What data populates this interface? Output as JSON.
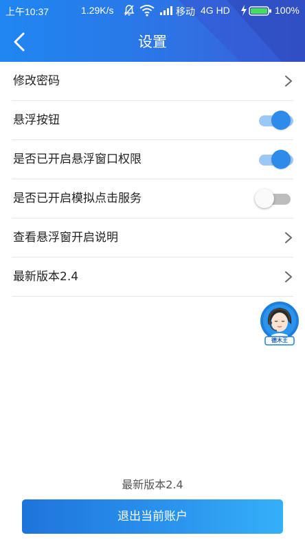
{
  "status_bar": {
    "time": "上午10:37",
    "network_speed": "1.29K/s",
    "carrier": "移动",
    "network_type": "4G HD",
    "battery_percent": "100%",
    "icons": [
      "bell-muted-icon",
      "wifi-icon",
      "signal-icon",
      "charging-bolt-icon",
      "battery-icon"
    ]
  },
  "header": {
    "title": "设置",
    "back_icon": "back-arrow-icon"
  },
  "settings": {
    "items": [
      {
        "label": "修改密码",
        "control": "chevron"
      },
      {
        "label": "悬浮按钮",
        "control": "toggle",
        "enabled": true
      },
      {
        "label": "是否已开启悬浮窗口权限",
        "control": "toggle",
        "enabled": true
      },
      {
        "label": "是否已开启模拟点击服务",
        "control": "toggle",
        "enabled": false
      },
      {
        "label": "查看悬浮窗开启说明",
        "control": "chevron"
      },
      {
        "label": "最新版本2.4",
        "control": "chevron"
      }
    ]
  },
  "floating_assistant": {
    "badge": "德木王",
    "icon": "assistant-avatar-icon"
  },
  "footer": {
    "version_text": "最新版本2.4",
    "logout_label": "退出当前账户"
  },
  "colors": {
    "header_primary": "#1f86f1",
    "toggle_on": "#2f8be9",
    "toggle_on_track": "#9cc8f5",
    "toggle_off_track": "#bdbdbd",
    "button_gradient_start": "#1e74dc",
    "button_gradient_end": "#35b0f7"
  }
}
